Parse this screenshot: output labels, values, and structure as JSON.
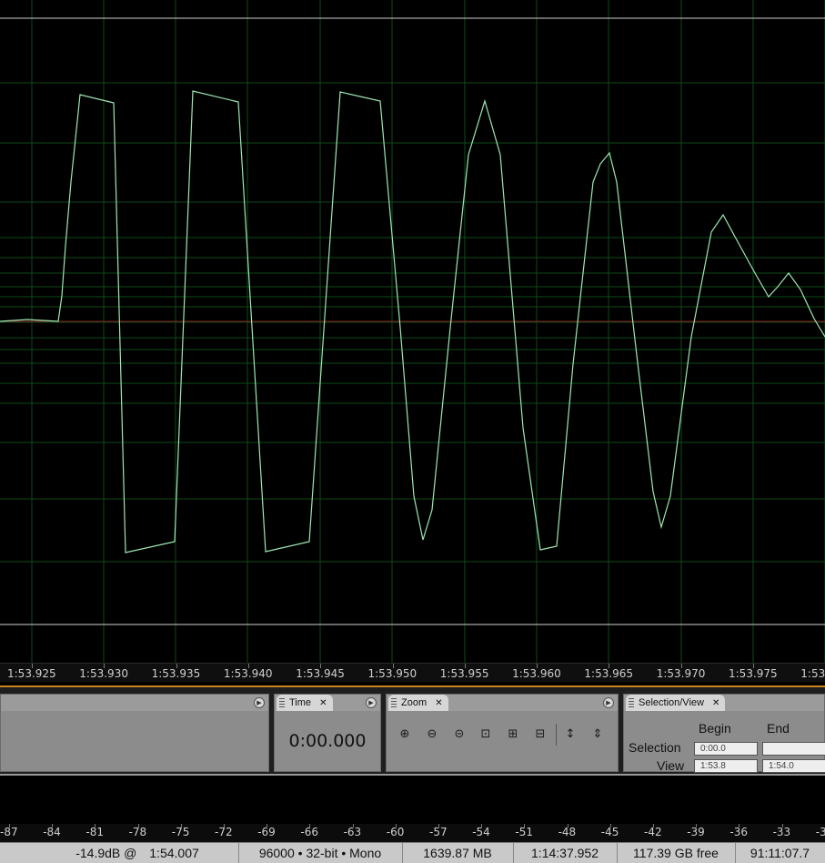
{
  "colors": {
    "waveform": "#9de8b4",
    "grid": "#0e4a19",
    "centerline": "#8a1c1c",
    "background": "#000000",
    "accent_bar": "#c9861f"
  },
  "timeline": {
    "labels": [
      "1:53.925",
      "1:53.930",
      "1:53.935",
      "1:53.940",
      "1:53.945",
      "1:53.950",
      "1:53.955",
      "1:53.960",
      "1:53.965",
      "1:53.970",
      "1:53.975",
      "1:53"
    ]
  },
  "panels": {
    "time": {
      "tab": "Time",
      "value": "0:00.000"
    },
    "zoom": {
      "tab": "Zoom",
      "icons": [
        "zoom-in-amplitude-icon",
        "zoom-out-amplitude-icon",
        "zoom-out-full-icon",
        "zoom-selection-icon",
        "zoom-left-edge-icon",
        "zoom-right-edge-icon",
        "zoom-in-vertical-icon",
        "zoom-out-vertical-icon"
      ]
    },
    "selection_view": {
      "tab": "Selection/View",
      "begin_header": "Begin",
      "end_header": "End",
      "selection_label": "Selection",
      "view_label": "View",
      "selection_begin": "0:00.0",
      "selection_end": "",
      "view_begin": "1:53.8",
      "view_end": "1:54.0"
    }
  },
  "level_meter": {
    "labels": [
      "-87",
      "-84",
      "-81",
      "-78",
      "-75",
      "-72",
      "-69",
      "-66",
      "-63",
      "-60",
      "-57",
      "-54",
      "-51",
      "-48",
      "-45",
      "-42",
      "-39",
      "-36",
      "-33",
      "-3"
    ]
  },
  "status": {
    "level": "-14.9dB @",
    "cursor_time": "1:54.007",
    "format": "96000 • 32-bit • Mono",
    "size": "1639.87 MB",
    "duration": "1:14:37.952",
    "free_space": "117.39 GB free",
    "free_time": "91:11:07.7"
  }
}
